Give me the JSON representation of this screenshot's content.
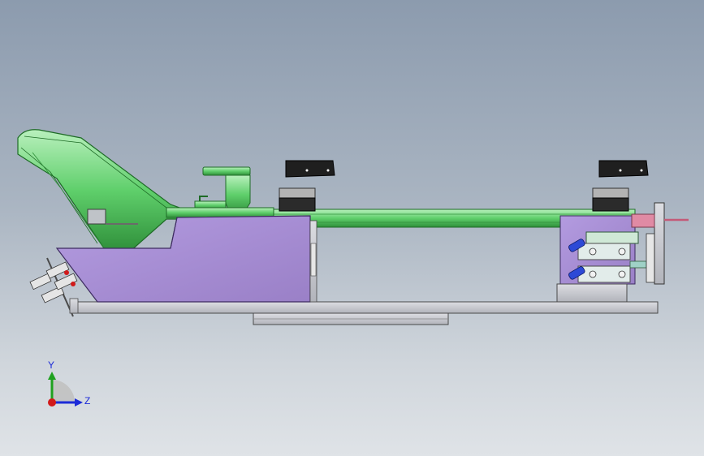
{
  "axes": {
    "y_label": "Y",
    "z_label": "Z",
    "colors": {
      "y": "#1fa11f",
      "z": "#1c2bd8",
      "origin": "#d11a1a"
    }
  },
  "colors": {
    "background_top": "#8c9bae",
    "background_bottom": "#dfe3e7",
    "frame_green": "#5fcf6b",
    "frame_green_dark": "#1e6b26",
    "plate_purple": "#a48bcf",
    "base_gray": "#c7c9cf",
    "motor_dark": "#2a2a2a",
    "fitting_blue": "#2d49d6",
    "accent_pink": "#e08aa4"
  }
}
